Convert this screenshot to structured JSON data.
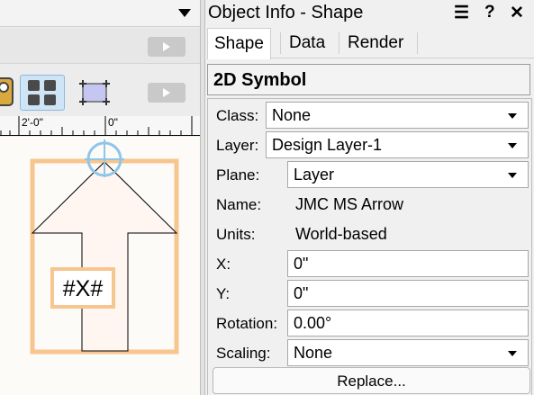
{
  "left_pane": {
    "top_menu_icon": "chevron-down-icon",
    "ruler_labels": [
      "2'-0\"",
      "0\""
    ],
    "symbol_text": "#X#",
    "colors": {
      "selection_outline": "#f7c58f",
      "locus": "#8ec5ea"
    }
  },
  "palette": {
    "title": "Object Info - Shape",
    "menu_icon": "hamburger-menu-icon",
    "help_icon": "help-icon",
    "close_icon": "close-icon",
    "tabs": [
      {
        "label": "Shape",
        "active": true
      },
      {
        "label": "Data",
        "active": false
      },
      {
        "label": "Render",
        "active": false
      }
    ],
    "object_type": "2D Symbol",
    "fields": {
      "class": {
        "label": "Class:",
        "value": "None"
      },
      "layer": {
        "label": "Layer:",
        "value": "Design Layer-1"
      },
      "plane": {
        "label": "Plane:",
        "value": "Layer"
      },
      "name": {
        "label": "Name:",
        "value": "JMC MS Arrow"
      },
      "units": {
        "label": "Units:",
        "value": "World-based"
      },
      "x": {
        "label": "X:",
        "value": "0\""
      },
      "y": {
        "label": "Y:",
        "value": "0\""
      },
      "rotation": {
        "label": "Rotation:",
        "value": "0.00°"
      },
      "scaling": {
        "label": "Scaling:",
        "value": "None"
      }
    },
    "replace_label": "Replace..."
  }
}
